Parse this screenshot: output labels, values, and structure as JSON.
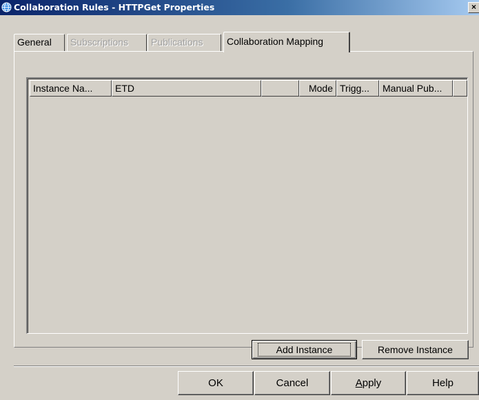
{
  "window": {
    "title": "Collaboration Rules - HTTPGet Properties",
    "close_glyph": "×",
    "icon": "globe-icon"
  },
  "tabs": [
    {
      "label": "General",
      "state": "normal"
    },
    {
      "label": "Subscriptions",
      "state": "disabled"
    },
    {
      "label": "Publications",
      "state": "disabled"
    },
    {
      "label": "Collaboration Mapping",
      "state": "active"
    }
  ],
  "table": {
    "columns": [
      "Instance Na...",
      "ETD",
      "",
      "Mode",
      "Trigg...",
      "Manual Pub...",
      ""
    ],
    "rows": []
  },
  "instance_buttons": {
    "add": "Add Instance",
    "remove": "Remove Instance"
  },
  "dialog_buttons": {
    "ok": "OK",
    "cancel": "Cancel",
    "apply_mnemonic": "A",
    "apply_rest": "pply",
    "help": "Help"
  },
  "colors": {
    "face": "#d4d0c8",
    "title_active": "#0a246a",
    "disabled_text": "#a0a0a0"
  }
}
